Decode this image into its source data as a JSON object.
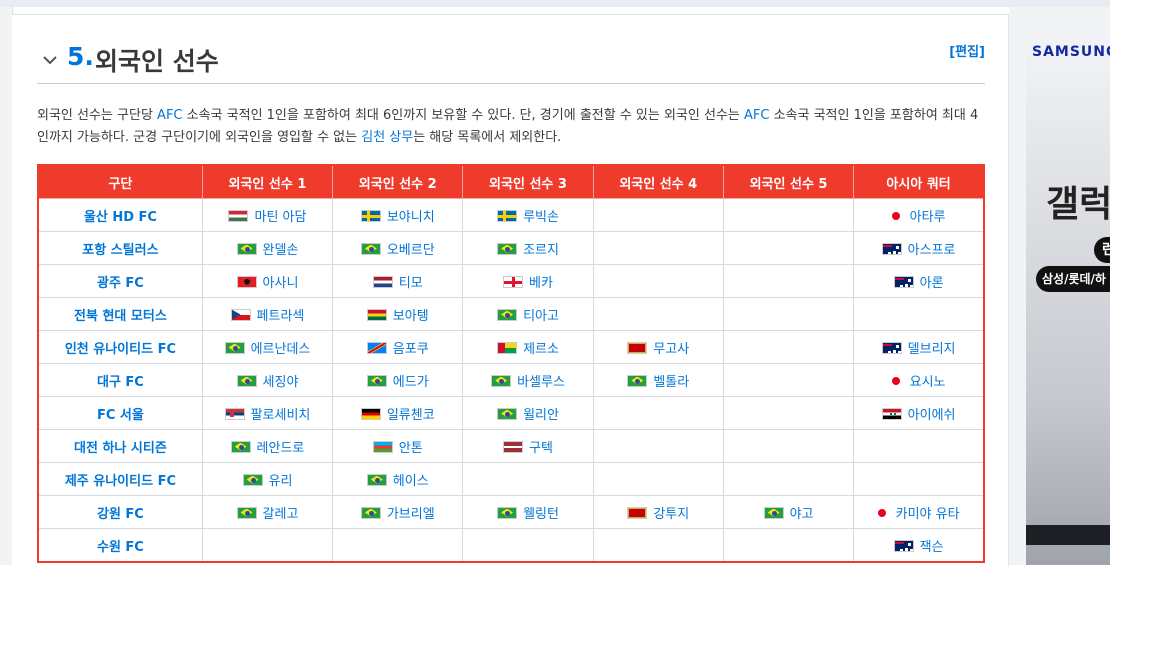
{
  "section": {
    "number": "5.",
    "title": "외국인 선수",
    "edit_label": "[편집]"
  },
  "paragraph": {
    "t1": "외국인 선수는 구단당 ",
    "afc1": "AFC",
    "t2": " 소속국 국적인 1인을 포함하여 최대 6인까지 보유할 수 있다. 단, 경기에 출전할 수 있는 외국인 선수는 ",
    "afc2": "AFC",
    "t3": " 소속국 국적인 1인을 포함하여 최대 4인까지 가능하다. 군경 구단이기에 외국인을 영입할 수 없는 ",
    "link": "김천 상무",
    "t4": "는 해당 목록에서 제외한다."
  },
  "table": {
    "headers": [
      "구단",
      "외국인 선수 1",
      "외국인 선수 2",
      "외국인 선수 3",
      "외국인 선수 4",
      "외국인 선수 5",
      "아시아 쿼터"
    ],
    "rows": [
      {
        "club": "울산 HD FC",
        "p": [
          {
            "flag": "hu",
            "name": "마틴 아담"
          },
          {
            "flag": "se",
            "name": "보야니치"
          },
          {
            "flag": "se",
            "name": "루빅손"
          },
          null,
          null,
          {
            "flag": "jp",
            "name": "아타루"
          }
        ]
      },
      {
        "club": "포항 스틸러스",
        "p": [
          {
            "flag": "br",
            "name": "완델손"
          },
          {
            "flag": "br",
            "name": "오베르단"
          },
          {
            "flag": "br",
            "name": "조르지"
          },
          null,
          null,
          {
            "flag": "au",
            "name": "아스프로"
          }
        ]
      },
      {
        "club": "광주 FC",
        "p": [
          {
            "flag": "al",
            "name": "아사니"
          },
          {
            "flag": "nl",
            "name": "티모"
          },
          {
            "flag": "ge",
            "name": "베카"
          },
          null,
          null,
          {
            "flag": "au",
            "name": "아론"
          }
        ]
      },
      {
        "club": "전북 현대 모터스",
        "p": [
          {
            "flag": "cz",
            "name": "페트라섹"
          },
          {
            "flag": "gh",
            "name": "보아텡"
          },
          {
            "flag": "br",
            "name": "티아고"
          },
          null,
          null,
          null
        ]
      },
      {
        "club": "인천 유나이티드 FC",
        "p": [
          {
            "flag": "br",
            "name": "에르난데스"
          },
          {
            "flag": "cd",
            "name": "음포쿠"
          },
          {
            "flag": "gw",
            "name": "제르소"
          },
          {
            "flag": "me",
            "name": "무고사"
          },
          null,
          {
            "flag": "au",
            "name": "델브리지"
          }
        ]
      },
      {
        "club": "대구 FC",
        "p": [
          {
            "flag": "br",
            "name": "세징야"
          },
          {
            "flag": "br",
            "name": "에드가"
          },
          {
            "flag": "br",
            "name": "바셀루스"
          },
          {
            "flag": "br",
            "name": "벨톨라"
          },
          null,
          {
            "flag": "jp",
            "name": "요시노"
          }
        ]
      },
      {
        "club": "FC 서울",
        "p": [
          {
            "flag": "rs",
            "name": "팔로세비치"
          },
          {
            "flag": "de",
            "name": "일류첸코"
          },
          {
            "flag": "br",
            "name": "윌리안"
          },
          null,
          null,
          {
            "flag": "sy",
            "name": "아이에쉬"
          }
        ]
      },
      {
        "club": "대전 하나 시티즌",
        "p": [
          {
            "flag": "br",
            "name": "레안드로"
          },
          {
            "flag": "az",
            "name": "안톤"
          },
          {
            "flag": "lv",
            "name": "구텍"
          },
          null,
          null,
          null
        ]
      },
      {
        "club": "제주 유나이티드 FC",
        "p": [
          {
            "flag": "br",
            "name": "유리"
          },
          {
            "flag": "br",
            "name": "헤이스"
          },
          null,
          null,
          null,
          null
        ]
      },
      {
        "club": "강원 FC",
        "p": [
          {
            "flag": "br",
            "name": "갈레고"
          },
          {
            "flag": "br",
            "name": "가브리엘"
          },
          {
            "flag": "br",
            "name": "웰링턴"
          },
          {
            "flag": "me",
            "name": "강투지"
          },
          {
            "flag": "br",
            "name": "야고"
          },
          {
            "flag": "jp",
            "name": "카미야 유타"
          }
        ]
      },
      {
        "club": "수원 FC",
        "p": [
          null,
          null,
          null,
          null,
          null,
          {
            "flag": "au",
            "name": "잭슨"
          }
        ]
      }
    ]
  },
  "ad": {
    "brand": "SAMSUNG",
    "title": "갤럭",
    "pill1": "런",
    "pill2": "삼성/롯데/하"
  },
  "colors": {
    "accent": "#0275d8",
    "table_header": "#ef3b2c",
    "japan_dot": "#e8001c"
  }
}
